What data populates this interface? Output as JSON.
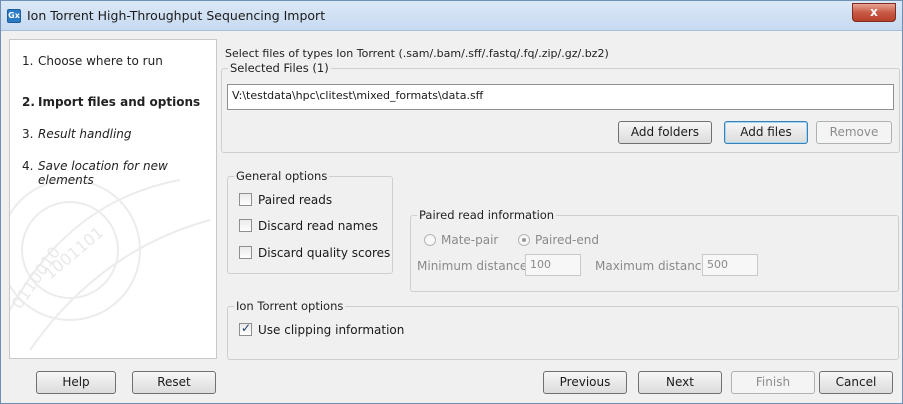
{
  "window": {
    "title": "Ion Torrent High-Throughput Sequencing Import",
    "app_icon_text": "Gx",
    "close_label": "x"
  },
  "steps": [
    {
      "num": "1.",
      "label": "Choose where to run",
      "state": "done"
    },
    {
      "num": "2.",
      "label": "Import files and options",
      "state": "active"
    },
    {
      "num": "3.",
      "label": "Result handling",
      "state": "future"
    },
    {
      "num": "4.",
      "label": "Save location for new elements",
      "state": "future"
    }
  ],
  "files": {
    "instruction": "Select files of types Ion Torrent (.sam/.bam/.sff/.fastq/.fq/.zip/.gz/.bz2)",
    "group_label": "Selected Files (1)",
    "items": [
      "V:\\testdata\\hpc\\clitest\\mixed_formats\\data.sff"
    ],
    "add_folders_label": "Add folders",
    "add_files_label": "Add files",
    "remove_label": "Remove"
  },
  "general_options": {
    "group_label": "General options",
    "paired_reads": {
      "label": "Paired reads",
      "checked": false
    },
    "discard_read_names": {
      "label": "Discard read names",
      "checked": false
    },
    "discard_quality_scores": {
      "label": "Discard quality scores",
      "checked": false
    }
  },
  "paired_info": {
    "group_label": "Paired read information",
    "mate_pair_label": "Mate-pair",
    "paired_end_label": "Paired-end",
    "selected": "paired-end",
    "min_distance_label": "Minimum distance",
    "min_distance_value": "100",
    "max_distance_label": "Maximum distance",
    "max_distance_value": "500"
  },
  "ion_torrent_options": {
    "group_label": "Ion Torrent options",
    "use_clipping": {
      "label": "Use clipping information",
      "checked": true
    }
  },
  "footer": {
    "help_label": "Help",
    "reset_label": "Reset",
    "previous_label": "Previous",
    "next_label": "Next",
    "finish_label": "Finish",
    "cancel_label": "Cancel"
  }
}
